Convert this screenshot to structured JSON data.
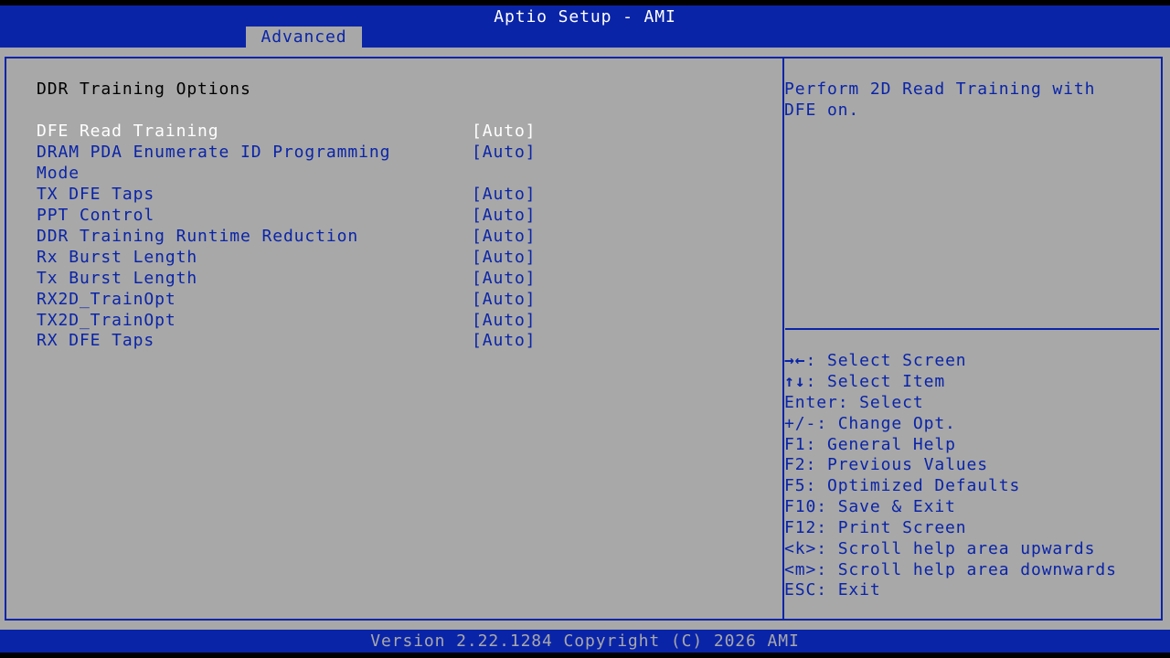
{
  "header": {
    "title": "Aptio Setup - AMI",
    "active_tab": "Advanced"
  },
  "page": {
    "section_title": "DDR Training Options"
  },
  "options": [
    {
      "label": "DFE Read Training",
      "value": "[Auto]",
      "selected": true
    },
    {
      "label": "DRAM PDA Enumerate ID Programming\nMode",
      "value": "[Auto]",
      "selected": false
    },
    {
      "label": "TX DFE Taps",
      "value": "[Auto]",
      "selected": false
    },
    {
      "label": "PPT Control",
      "value": "[Auto]",
      "selected": false
    },
    {
      "label": "DDR Training Runtime Reduction",
      "value": "[Auto]",
      "selected": false
    },
    {
      "label": "Rx Burst Length",
      "value": "[Auto]",
      "selected": false
    },
    {
      "label": "Tx Burst Length",
      "value": "[Auto]",
      "selected": false
    },
    {
      "label": "RX2D_TrainOpt",
      "value": "[Auto]",
      "selected": false
    },
    {
      "label": "TX2D_TrainOpt",
      "value": "[Auto]",
      "selected": false
    },
    {
      "label": "RX DFE Taps",
      "value": "[Auto]",
      "selected": false
    }
  ],
  "help": {
    "lines": [
      "Perform 2D Read Training with",
      "DFE on."
    ]
  },
  "keys": [
    {
      "key": "→←",
      "desc": ": Select Screen"
    },
    {
      "key": "↑↓",
      "desc": ": Select Item"
    },
    {
      "key": "Enter",
      "desc": ": Select"
    },
    {
      "key": "+/-",
      "desc": ": Change Opt."
    },
    {
      "key": "F1",
      "desc": ": General Help"
    },
    {
      "key": "F2",
      "desc": ": Previous Values"
    },
    {
      "key": "F5",
      "desc": ": Optimized Defaults"
    },
    {
      "key": "F10",
      "desc": ": Save & Exit"
    },
    {
      "key": "F12",
      "desc": ": Print Screen"
    },
    {
      "key": "<k>",
      "desc": ": Scroll help area upwards"
    },
    {
      "key": "<m>",
      "desc": ": Scroll help area downwards"
    },
    {
      "key": "ESC",
      "desc": ": Exit"
    }
  ],
  "footer": {
    "version": "Version 2.22.1284 Copyright (C) 2026 AMI"
  },
  "colors": {
    "blue": "#0a24a8",
    "gray": "#a8a8a8",
    "white": "#ffffff",
    "black": "#000000"
  }
}
